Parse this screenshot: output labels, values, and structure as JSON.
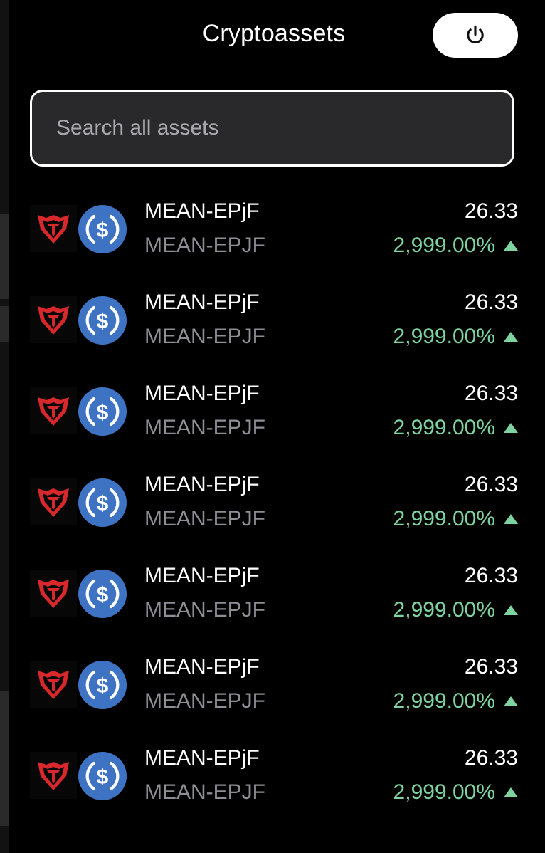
{
  "header": {
    "title": "Cryptoassets",
    "power_icon": "power-icon"
  },
  "search": {
    "placeholder": "Search all assets",
    "value": ""
  },
  "colors": {
    "background": "#000000",
    "search_bg": "#29292b",
    "positive": "#7fd3a0",
    "muted_text": "#8e8e96",
    "usdc_blue": "#3e73c4",
    "mean_red": "#d8282b"
  },
  "assets": [
    {
      "name": "MEAN-EPjF",
      "symbol": "MEAN-EPJF",
      "price": "26.33",
      "change": "2,999.00%",
      "trend": "up",
      "icons": [
        "mean-token-icon",
        "usdc-token-icon"
      ]
    },
    {
      "name": "MEAN-EPjF",
      "symbol": "MEAN-EPJF",
      "price": "26.33",
      "change": "2,999.00%",
      "trend": "up",
      "icons": [
        "mean-token-icon",
        "usdc-token-icon"
      ]
    },
    {
      "name": "MEAN-EPjF",
      "symbol": "MEAN-EPJF",
      "price": "26.33",
      "change": "2,999.00%",
      "trend": "up",
      "icons": [
        "mean-token-icon",
        "usdc-token-icon"
      ]
    },
    {
      "name": "MEAN-EPjF",
      "symbol": "MEAN-EPJF",
      "price": "26.33",
      "change": "2,999.00%",
      "trend": "up",
      "icons": [
        "mean-token-icon",
        "usdc-token-icon"
      ]
    },
    {
      "name": "MEAN-EPjF",
      "symbol": "MEAN-EPJF",
      "price": "26.33",
      "change": "2,999.00%",
      "trend": "up",
      "icons": [
        "mean-token-icon",
        "usdc-token-icon"
      ]
    },
    {
      "name": "MEAN-EPjF",
      "symbol": "MEAN-EPJF",
      "price": "26.33",
      "change": "2,999.00%",
      "trend": "up",
      "icons": [
        "mean-token-icon",
        "usdc-token-icon"
      ]
    },
    {
      "name": "MEAN-EPjF",
      "symbol": "MEAN-EPJF",
      "price": "26.33",
      "change": "2,999.00%",
      "trend": "up",
      "icons": [
        "mean-token-icon",
        "usdc-token-icon"
      ]
    }
  ]
}
